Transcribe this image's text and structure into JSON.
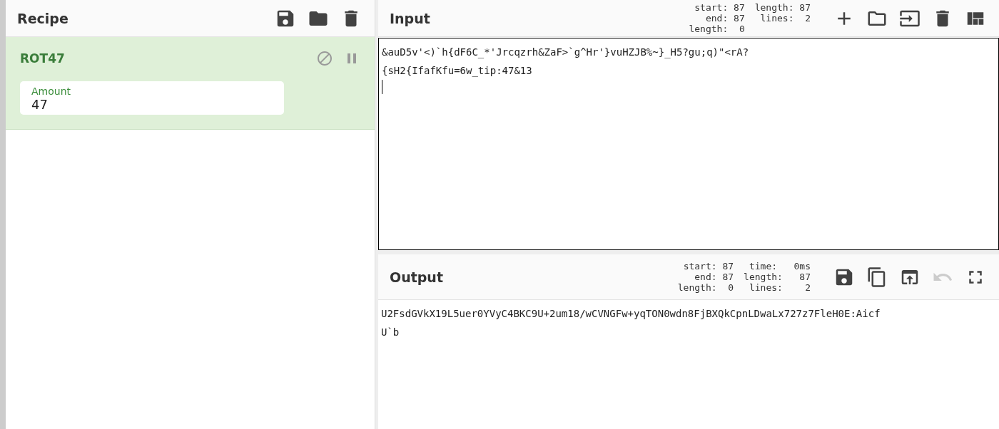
{
  "recipe": {
    "title": "Recipe",
    "operations": [
      {
        "name": "ROT47",
        "disabled": false,
        "paused": false,
        "args": [
          {
            "label": "Amount",
            "value": "47"
          }
        ]
      }
    ]
  },
  "input": {
    "title": "Input",
    "stats": [
      [
        "start: 87",
        "end: 87",
        "length:  0"
      ],
      [
        "length: 87",
        "lines:  2"
      ]
    ],
    "lines": [
      "&auD5v'<)`h{dF6C_*'Jrcqzrh&ZaF>`g^Hr'}vuHZJB%~}_H5?gu;q)\"<rA?",
      "{sH2{IfafKfu=6w_tip:47&13"
    ]
  },
  "output": {
    "title": "Output",
    "stats": [
      [
        "start: 87",
        "end: 87",
        "length:  0"
      ],
      [
        "time:   0ms",
        "length:   87",
        "lines:    2"
      ]
    ],
    "lines": [
      "U2FsdGVkX19L5uer0YVyC4BKC9U+2um18/wCVNGFw+yqTON0wdn8FjBXQkCpnLDwaLx727z7FleH0E:Aicf",
      "U`b"
    ],
    "undo_disabled": true
  }
}
